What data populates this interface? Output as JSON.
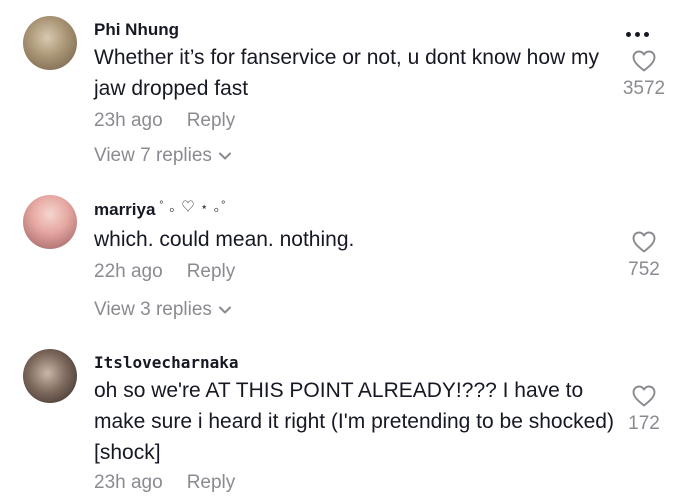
{
  "comments": [
    {
      "username": "Phi Nhung",
      "text": "Whether it’s for fanservice or not, u dont know how my jaw dropped fast",
      "time": "23h ago",
      "reply": "Reply",
      "view_replies": "View 7 replies",
      "likes": "3572"
    },
    {
      "username": "marriya",
      "username_deco": "˚ ｡ ♡ ⋆ ｡˚",
      "text": "which. could mean. nothing.",
      "time": "22h ago",
      "reply": "Reply",
      "view_replies": "View 3 replies",
      "likes": "752"
    },
    {
      "username": "Itslovecharnaka",
      "text": "oh so we're AT THIS POINT ALREADY!??? I have to make sure i heard it right (I'm pretending to be shocked) [shock]",
      "time": "23h ago",
      "reply": "Reply",
      "likes": "172"
    }
  ],
  "icons": {
    "more": "more-horizontal-icon",
    "like": "heart-outline-icon",
    "expand": "chevron-down-icon"
  },
  "colors": {
    "text": "#161823",
    "secondary": "#8a8b91",
    "background": "#ffffff"
  }
}
